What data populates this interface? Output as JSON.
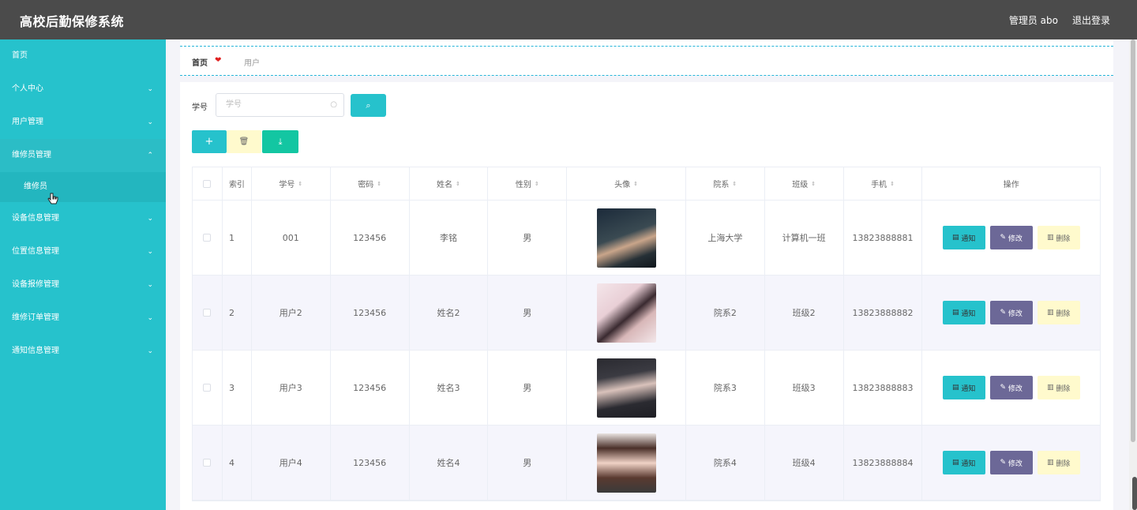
{
  "header": {
    "title": "高校后勤保修系统",
    "user": "管理员 abo",
    "logout": "退出登录"
  },
  "sidebar": {
    "items": [
      {
        "label": "首页",
        "chevron": ""
      },
      {
        "label": "个人中心",
        "chevron": "⌄"
      },
      {
        "label": "用户管理",
        "chevron": "⌄"
      },
      {
        "label": "维修员管理",
        "chevron": "⌃"
      },
      {
        "label": "设备信息管理",
        "chevron": "⌄"
      },
      {
        "label": "位置信息管理",
        "chevron": "⌄"
      },
      {
        "label": "设备报修管理",
        "chevron": "⌄"
      },
      {
        "label": "维修订单管理",
        "chevron": "⌄"
      },
      {
        "label": "通知信息管理",
        "chevron": "⌄"
      }
    ],
    "sub_item": "维修员"
  },
  "breadcrumb": {
    "home": "首页",
    "separator": "❤",
    "current": "用户"
  },
  "search": {
    "label": "学号",
    "placeholder": "学号"
  },
  "table": {
    "columns": [
      "索引",
      "学号",
      "密码",
      "姓名",
      "性别",
      "头像",
      "院系",
      "班级",
      "手机",
      "操作"
    ],
    "rows": [
      {
        "idx": "1",
        "no": "001",
        "pwd": "123456",
        "name": "李铭",
        "sex": "男",
        "dept": "上海大学",
        "cls": "计算机一班",
        "phone": "13823888881"
      },
      {
        "idx": "2",
        "no": "用户2",
        "pwd": "123456",
        "name": "姓名2",
        "sex": "男",
        "dept": "院系2",
        "cls": "班级2",
        "phone": "13823888882"
      },
      {
        "idx": "3",
        "no": "用户3",
        "pwd": "123456",
        "name": "姓名3",
        "sex": "男",
        "dept": "院系3",
        "cls": "班级3",
        "phone": "13823888883"
      },
      {
        "idx": "4",
        "no": "用户4",
        "pwd": "123456",
        "name": "姓名4",
        "sex": "男",
        "dept": "院系4",
        "cls": "班级4",
        "phone": "13823888884"
      }
    ],
    "actions": {
      "notify": "通知",
      "edit": "修改",
      "remove": "删除"
    }
  },
  "colors": {
    "accent": "#26c2cc",
    "header": "#4b4b4b",
    "edit": "#6c6897",
    "download": "#13c6a2",
    "remove": "#fffacd"
  }
}
